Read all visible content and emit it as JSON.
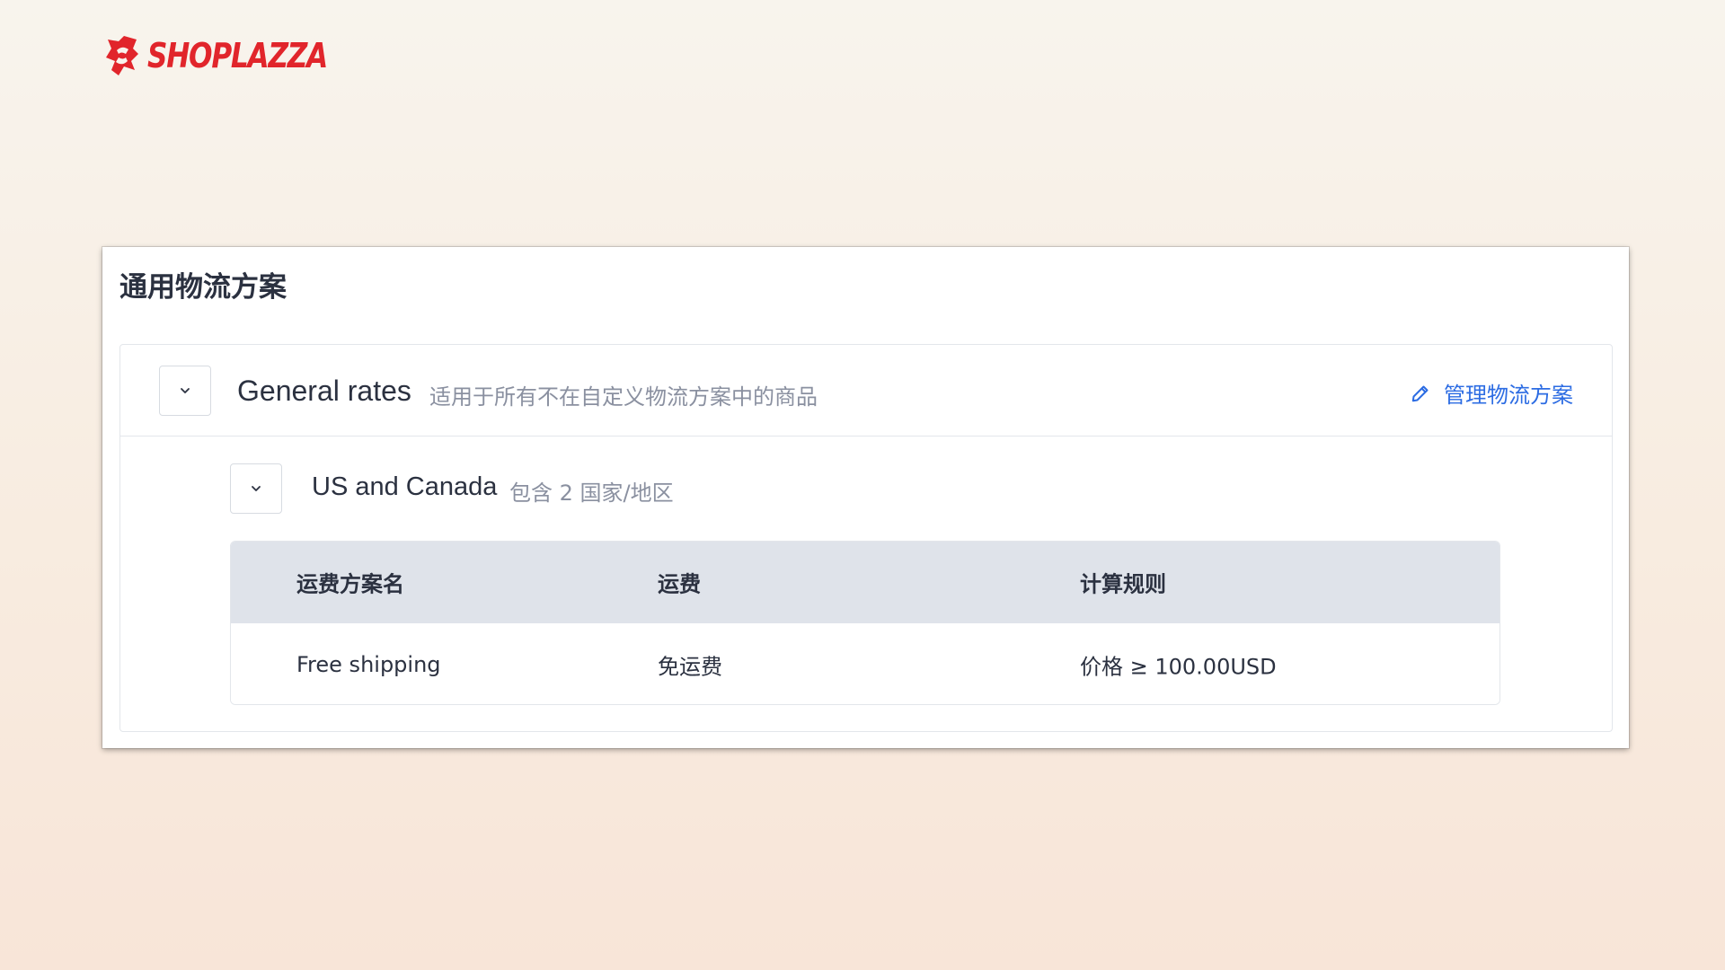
{
  "brand": {
    "name": "SHOPLAZZA",
    "color": "#e1252b"
  },
  "panel": {
    "title": "通用物流方案"
  },
  "zone": {
    "name": "General rates",
    "description": "适用于所有不在自定义物流方案中的商品",
    "manage_link": "管理物流方案",
    "link_color": "#2c6ce3",
    "expand_icon": "chevron-down-icon",
    "edit_icon": "pencil-icon"
  },
  "region": {
    "name": "US and Canada",
    "description": "包含 2 国家/地区",
    "expand_icon": "chevron-down-icon"
  },
  "rates_table": {
    "columns": [
      "运费方案名",
      "运费",
      "计算规则"
    ],
    "rows": [
      [
        "Free shipping",
        "免运费",
        "价格 ≥ 100.00USD"
      ]
    ]
  }
}
